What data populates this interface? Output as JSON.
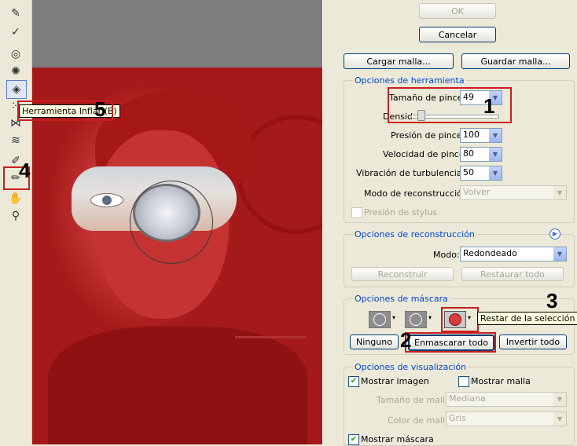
{
  "toolbar": {
    "tools": [
      {
        "name": "forward-warp-icon",
        "glyph": "✎"
      },
      {
        "name": "reconstruct-icon",
        "glyph": "✓"
      },
      {
        "name": "twirl-icon",
        "glyph": "◎"
      },
      {
        "name": "pucker-icon",
        "glyph": "✺"
      },
      {
        "name": "bloat-icon",
        "glyph": "◈"
      },
      {
        "name": "push-left-icon",
        "glyph": "⁙"
      },
      {
        "name": "mirror-icon",
        "glyph": "⋈"
      },
      {
        "name": "turbulence-icon",
        "glyph": "≋"
      },
      {
        "name": "freeze-mask-icon",
        "glyph": "✐"
      },
      {
        "name": "thaw-mask-icon",
        "glyph": "✏"
      },
      {
        "name": "hand-icon",
        "glyph": "✋"
      },
      {
        "name": "zoom-icon",
        "glyph": "⚲"
      }
    ]
  },
  "tooltip_tool": "Herramienta Inflar (B)",
  "tooltip_mask": "Restar de la selección",
  "annotations": {
    "n1": "1",
    "n2": "2",
    "n3": "3",
    "n4": "4",
    "n5": "5"
  },
  "buttons": {
    "ok": "OK",
    "cancel": "Cancelar",
    "load_mesh": "Cargar malla...",
    "save_mesh": "Guardar malla...",
    "reconstruct": "Reconstruir",
    "restore_all": "Restaurar todo",
    "none": "Ninguno",
    "mask_all": "Enmascarar todo",
    "invert_all": "Invertir todo"
  },
  "tool_options": {
    "title": "Opciones de herramienta",
    "brush_size_label": "Tamaño de pincel:",
    "brush_size_value": "49",
    "density_label": "Densid",
    "pressure_label": "Presión de pincel:",
    "pressure_value": "100",
    "speed_label": "Velocidad de pincel:",
    "speed_value": "80",
    "jitter_label": "Vibración de turbulencia:",
    "jitter_value": "50",
    "mode_label": "Modo de reconstrucción:",
    "mode_value": "Volver",
    "stylus_label": "Presión de stylus"
  },
  "recon_options": {
    "title": "Opciones de reconstrucción",
    "mode_label": "Modo:",
    "mode_value": "Redondeado"
  },
  "mask_options": {
    "title": "Opciones de máscara"
  },
  "view_options": {
    "title": "Opciones de visualización",
    "show_image": "Mostrar imagen",
    "show_mesh": "Mostrar malla",
    "mesh_size_label": "Tamaño de malla:",
    "mesh_size_value": "Mediana",
    "mesh_color_label": "Color de malla:",
    "mesh_color_value": "Gris",
    "show_mask": "Mostrar máscara"
  },
  "colors": {
    "annotation_red": "#c81e1e",
    "mask_red": "#c63636",
    "title_blue": "#0046d5"
  }
}
